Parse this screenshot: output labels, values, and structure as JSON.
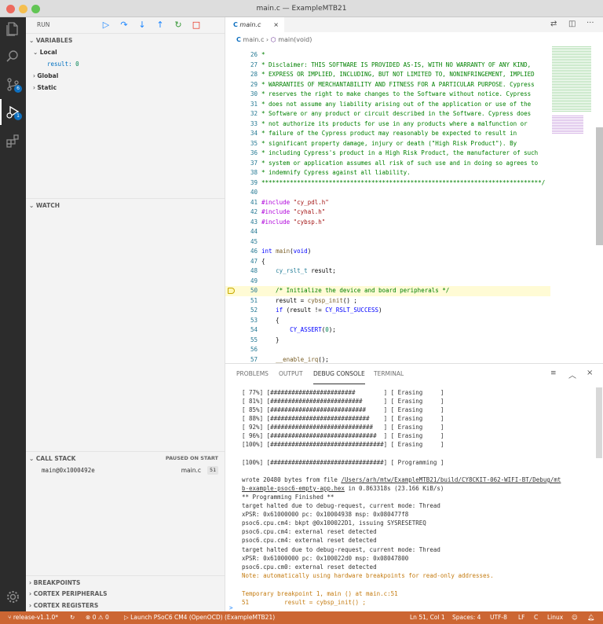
{
  "window": {
    "title": "main.c — ExampleMTB21"
  },
  "activity": {
    "scm_badge": "6",
    "debug_badge": "1"
  },
  "sidebar": {
    "run_label": "RUN",
    "variables": {
      "header": "VARIABLES",
      "local": "Local",
      "result_name": "result:",
      "result_value": "0",
      "global": "Global",
      "static": "Static"
    },
    "watch": {
      "header": "WATCH"
    },
    "callstack": {
      "header": "CALL STACK",
      "status": "PAUSED ON START",
      "frame": "main@0x1000492e",
      "file": "main.c",
      "line": "51"
    },
    "breakpoints": "BREAKPOINTS",
    "cortex_peripherals": "CORTEX PERIPHERALS",
    "cortex_registers": "CORTEX REGISTERS"
  },
  "editor": {
    "tab": "main.c",
    "breadcrumb_file": "main.c",
    "breadcrumb_func": "main(void)",
    "lines": [
      {
        "n": "26",
        "t": "*"
      },
      {
        "n": "27",
        "t": "* Disclaimer: THIS SOFTWARE IS PROVIDED AS-IS, WITH NO WARRANTY OF ANY KIND,"
      },
      {
        "n": "28",
        "t": "* EXPRESS OR IMPLIED, INCLUDING, BUT NOT LIMITED TO, NONINFRINGEMENT, IMPLIED"
      },
      {
        "n": "29",
        "t": "* WARRANTIES OF MERCHANTABILITY AND FITNESS FOR A PARTICULAR PURPOSE. Cypress"
      },
      {
        "n": "30",
        "t": "* reserves the right to make changes to the Software without notice. Cypress"
      },
      {
        "n": "31",
        "t": "* does not assume any liability arising out of the application or use of the"
      },
      {
        "n": "32",
        "t": "* Software or any product or circuit described in the Software. Cypress does"
      },
      {
        "n": "33",
        "t": "* not authorize its products for use in any products where a malfunction or"
      },
      {
        "n": "34",
        "t": "* failure of the Cypress product may reasonably be expected to result in"
      },
      {
        "n": "35",
        "t": "* significant property damage, injury or death (\"High Risk Product\"). By"
      },
      {
        "n": "36",
        "t": "* including Cypress's product in a High Risk Product, the manufacturer of such"
      },
      {
        "n": "37",
        "t": "* system or application assumes all risk of such use and in doing so agrees to"
      },
      {
        "n": "38",
        "t": "* indemnify Cypress against all liability."
      },
      {
        "n": "39",
        "t": "*******************************************************************************/"
      },
      {
        "n": "40",
        "t": ""
      },
      {
        "n": "41",
        "t": "#include \"cy_pdl.h\""
      },
      {
        "n": "42",
        "t": "#include \"cyhal.h\""
      },
      {
        "n": "43",
        "t": "#include \"cybsp.h\""
      },
      {
        "n": "44",
        "t": ""
      },
      {
        "n": "45",
        "t": ""
      },
      {
        "n": "46",
        "t": "int main(void)"
      },
      {
        "n": "47",
        "t": "{"
      },
      {
        "n": "48",
        "t": "    cy_rslt_t result;"
      },
      {
        "n": "49",
        "t": ""
      },
      {
        "n": "50",
        "t": "    /* Initialize the device and board peripherals */"
      },
      {
        "n": "51",
        "t": "    result = cybsp_init() ;"
      },
      {
        "n": "52",
        "t": "    if (result != CY_RSLT_SUCCESS)"
      },
      {
        "n": "53",
        "t": "    {"
      },
      {
        "n": "54",
        "t": "        CY_ASSERT(0);"
      },
      {
        "n": "55",
        "t": "    }"
      },
      {
        "n": "56",
        "t": ""
      },
      {
        "n": "57",
        "t": "    __enable_irq();"
      }
    ]
  },
  "panel": {
    "tabs": [
      "PROBLEMS",
      "OUTPUT",
      "DEBUG CONSOLE",
      "TERMINAL"
    ],
    "active_tab": "DEBUG CONSOLE",
    "lines": [
      {
        "t": "[ 77%] [########################        ] [ Erasing     ]",
        "c": ""
      },
      {
        "t": "[ 81%] [##########################      ] [ Erasing     ]",
        "c": ""
      },
      {
        "t": "[ 85%] [###########################     ] [ Erasing     ]",
        "c": ""
      },
      {
        "t": "[ 88%] [############################    ] [ Erasing     ]",
        "c": ""
      },
      {
        "t": "[ 92%] [#############################   ] [ Erasing     ]",
        "c": ""
      },
      {
        "t": "[ 96%] [##############################  ] [ Erasing     ]",
        "c": ""
      },
      {
        "t": "[100%] [################################] [ Erasing     ]",
        "c": ""
      },
      {
        "t": "",
        "c": ""
      },
      {
        "t": "[100%] [################################] [ Programming ]",
        "c": ""
      },
      {
        "t": "",
        "c": ""
      },
      {
        "t": "wrote 20480 bytes from file /Users/arh/mtw/ExampleMTB21/build/CY8CKIT-062-WIFI-BT/Debug/mt",
        "c": ""
      },
      {
        "t": "b-example-psoc6-empty-app.hex in 0.863318s (23.166 KiB/s)",
        "c": ""
      },
      {
        "t": "** Programming Finished **",
        "c": ""
      },
      {
        "t": "target halted due to debug-request, current mode: Thread",
        "c": ""
      },
      {
        "t": "xPSR: 0x61000000 pc: 0x10004938 msp: 0x080477f8",
        "c": ""
      },
      {
        "t": "psoc6.cpu.cm4: bkpt @0x100022D1, issuing SYSRESETREQ",
        "c": ""
      },
      {
        "t": "psoc6.cpu.cm4: external reset detected",
        "c": ""
      },
      {
        "t": "psoc6.cpu.cm4: external reset detected",
        "c": ""
      },
      {
        "t": "target halted due to debug-request, current mode: Thread",
        "c": ""
      },
      {
        "t": "xPSR: 0x61000000 pc: 0x100022d0 msp: 0x08047800",
        "c": ""
      },
      {
        "t": "psoc6.cpu.cm0: external reset detected",
        "c": ""
      },
      {
        "t": "Note: automatically using hardware breakpoints for read-only addresses.",
        "c": "warn"
      },
      {
        "t": "",
        "c": ""
      },
      {
        "t": "Temporary breakpoint 1, main () at main.c:51",
        "c": "warn"
      },
      {
        "t": "51          result = cybsp_init() ;",
        "c": "warn"
      }
    ],
    "prompt": ">"
  },
  "statusbar": {
    "branch": "release-v1.1.0*",
    "errors": "0",
    "warnings": "0",
    "launch": "Launch PSoC6 CM4 (OpenOCD) (ExampleMTB21)",
    "position": "Ln 51, Col 1",
    "spaces": "Spaces: 4",
    "encoding": "UTF-8",
    "eol": "LF",
    "language": "C",
    "os": "Linux"
  },
  "colors": {
    "statusbar": "#cc6633",
    "accent": "#1a85ff",
    "activity": "#2c2c2c"
  }
}
